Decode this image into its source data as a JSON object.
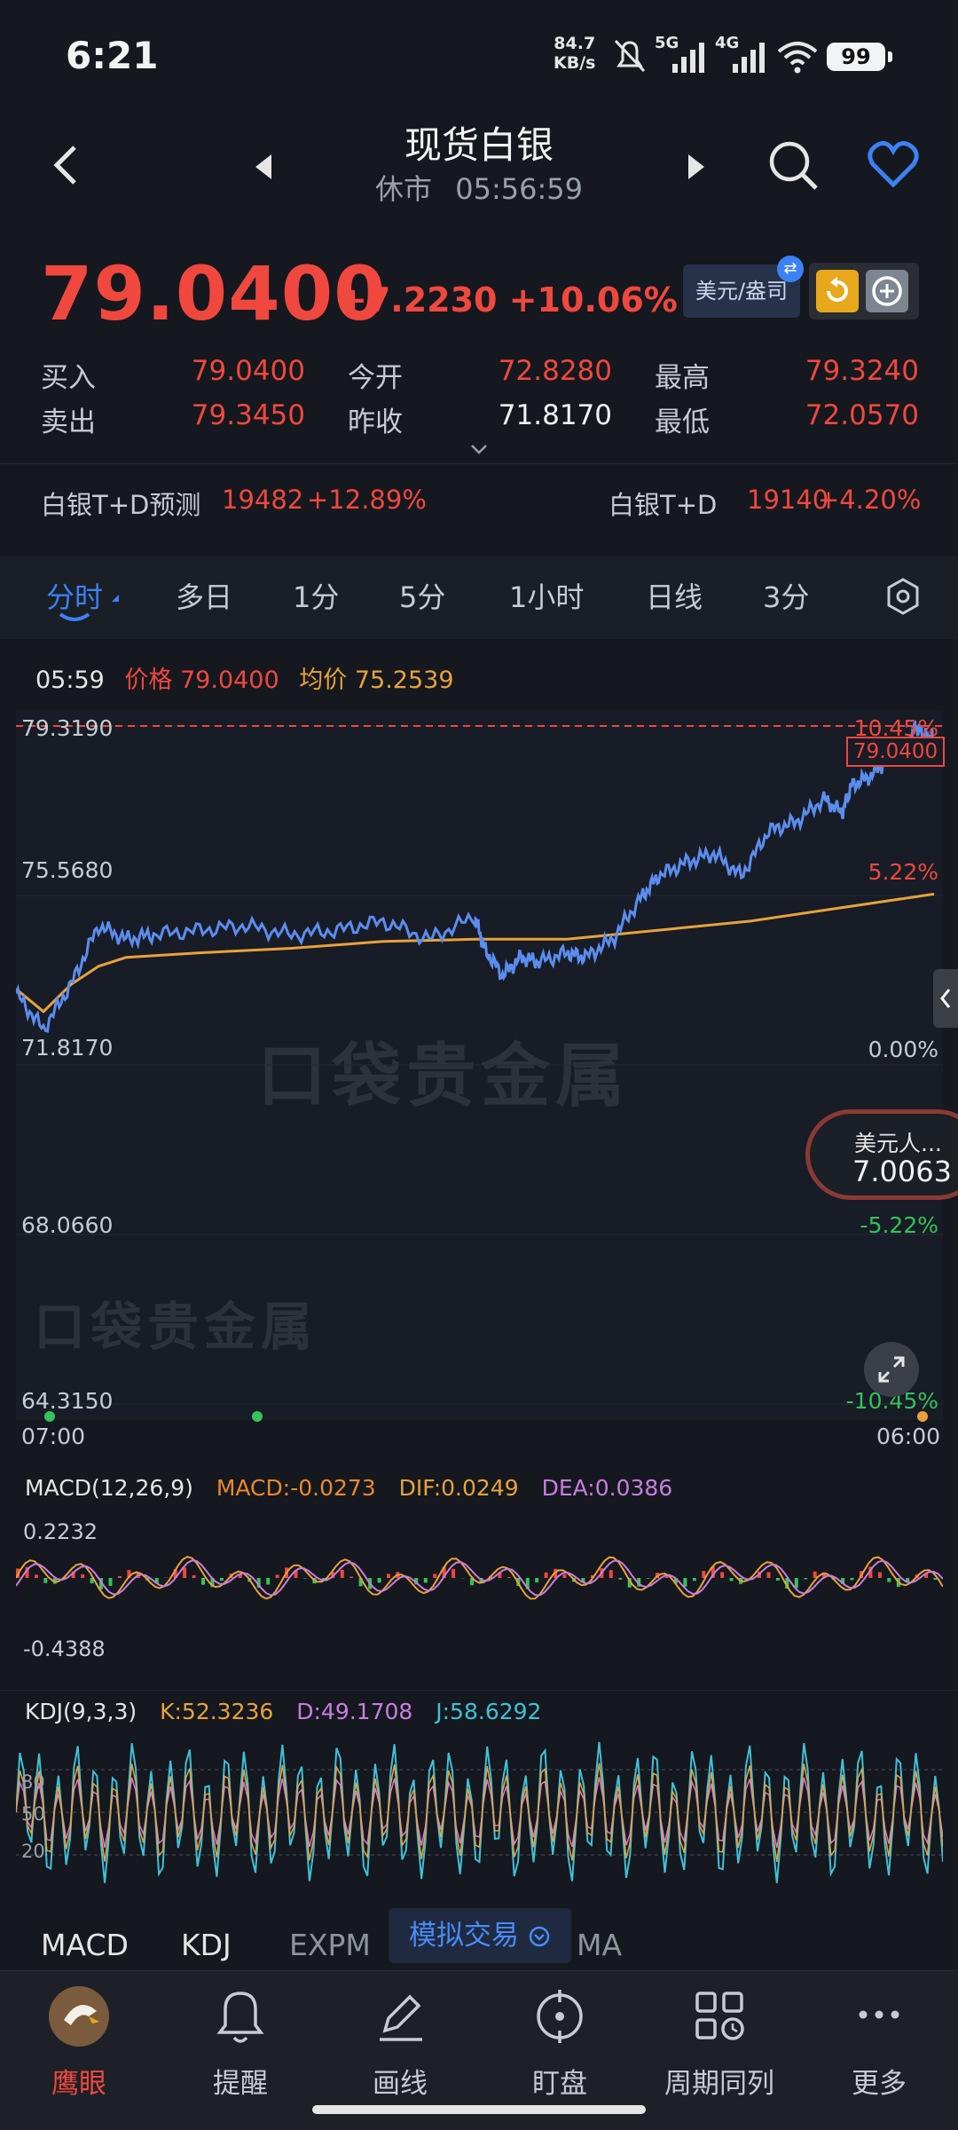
{
  "status_bar": {
    "time": "6:21",
    "speed_value": "84.7",
    "speed_unit": "KB/s",
    "net1": "5G",
    "net2": "4G",
    "battery": "99"
  },
  "header": {
    "title": "现货白银",
    "market_status": "休市",
    "clock": "05:56:59"
  },
  "quote": {
    "price": "79.0400",
    "change": "+7.2230",
    "change_pct": "+10.06%",
    "unit_chip": "美元/盎司",
    "unit_chip_badge": "⇄",
    "stats": [
      {
        "label": "买入",
        "value": "79.0400",
        "color": "#f0483e"
      },
      {
        "label": "今开",
        "value": "72.8280",
        "color": "#f0483e"
      },
      {
        "label": "最高",
        "value": "79.3240",
        "color": "#f0483e"
      },
      {
        "label": "卖出",
        "value": "79.3450",
        "color": "#f0483e"
      },
      {
        "label": "昨收",
        "value": "71.8170",
        "color": "#f2f3f5"
      },
      {
        "label": "最低",
        "value": "72.0570",
        "color": "#f0483e"
      }
    ]
  },
  "forecast": {
    "left_label": "白银T+D预测",
    "left_value": "19482",
    "left_pct": "+12.89%",
    "right_label": "白银T+D",
    "right_value": "19140",
    "right_pct": "+4.20%"
  },
  "tabs": [
    "分时",
    "多日",
    "1分",
    "5分",
    "1小时",
    "日线",
    "3分"
  ],
  "info_line": {
    "time": "05:59",
    "price_label": "价格",
    "price": "79.0400",
    "avg_label": "均价",
    "avg": "75.2539"
  },
  "chart_data": {
    "type": "line",
    "title": "",
    "y_axis_labels": [
      "79.3190",
      "75.5680",
      "71.8170",
      "68.0660",
      "64.3150"
    ],
    "y_pct_labels": [
      "10.45%",
      "5.22%",
      "0.00%",
      "-5.22%",
      "-10.45%"
    ],
    "x_labels": [
      "07:00",
      "06:00"
    ],
    "ylim": [
      64.315,
      79.319
    ],
    "reference_line": 79.319,
    "current_price_tag": "79.0400",
    "grid": true,
    "series": [
      {
        "name": "价格",
        "color": "#5b8def",
        "x": [
          0,
          3,
          6,
          9,
          12,
          15,
          20,
          25,
          30,
          35,
          40,
          45,
          50,
          51,
          53,
          55,
          57,
          60,
          62,
          65,
          68,
          70,
          73,
          76,
          79,
          82,
          85,
          88,
          90,
          91,
          93,
          95,
          97,
          98,
          99,
          100
        ],
        "values": [
          73.4,
          72.6,
          73.6,
          74.9,
          74.6,
          74.7,
          74.8,
          74.9,
          74.7,
          74.8,
          75.0,
          74.6,
          75.1,
          74.4,
          73.8,
          74.2,
          74.1,
          74.3,
          74.2,
          74.6,
          75.5,
          76.0,
          76.3,
          76.5,
          76.0,
          77.0,
          77.2,
          77.7,
          77.4,
          78.0,
          78.2,
          78.6,
          78.8,
          79.3,
          79.1,
          79.04
        ]
      },
      {
        "name": "均价",
        "color": "#e9a23b",
        "x": [
          0,
          3,
          6,
          9,
          12,
          20,
          30,
          40,
          50,
          60,
          70,
          80,
          90,
          100
        ],
        "values": [
          73.5,
          73.0,
          73.6,
          74.0,
          74.2,
          74.3,
          74.4,
          74.55,
          74.6,
          74.6,
          74.8,
          75.0,
          75.3,
          75.6
        ]
      }
    ]
  },
  "fx_pill": {
    "label": "美元人...",
    "value": "7.0063"
  },
  "watermark": "口袋贵金属",
  "macd": {
    "title": "MACD(12,26,9)",
    "macd": "MACD:-0.0273",
    "dif": "DIF:0.0249",
    "dea": "DEA:0.0386",
    "ymax": "0.2232",
    "ymin": "-0.4388",
    "colors": {
      "macd": "#e9892f",
      "dif": "#e9a23b",
      "dea": "#c77ee0"
    }
  },
  "kdj": {
    "title": "KDJ(9,3,3)",
    "k": "K:52.3236",
    "d": "D:49.1708",
    "j": "J:58.6292",
    "levels": [
      "80",
      "50",
      "20"
    ],
    "colors": {
      "k": "#e9a23b",
      "d": "#c77ee0",
      "j": "#3fc1d9"
    }
  },
  "indicator_tabs": [
    "MACD",
    "KDJ",
    "EXPM",
    "MA"
  ],
  "sim_trade": "模拟交易",
  "bottom_nav": [
    "鹰眼",
    "提醒",
    "画线",
    "盯盘",
    "周期同列",
    "更多"
  ],
  "colors": {
    "up": "#f0483e",
    "down": "#35c25a",
    "accent": "#3b82f6"
  }
}
